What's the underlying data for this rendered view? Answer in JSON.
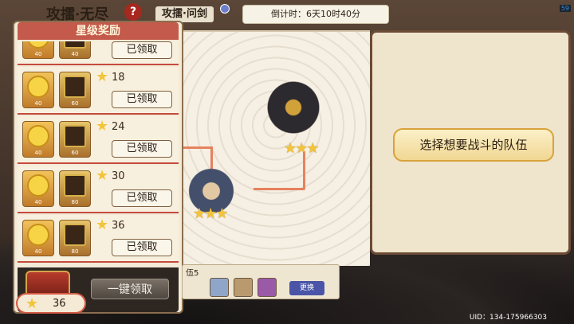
{
  "header": {
    "title": "攻擂·无尽",
    "help_glyph": "?",
    "subtitle": "攻擂·问剑",
    "countdown": "倒计时：6天10时40分",
    "corner_number": "59"
  },
  "rewards_panel": {
    "title": "星级奖励",
    "rows": [
      {
        "coin_count": "40",
        "book_count": "40",
        "stars": "",
        "button": "已领取"
      },
      {
        "coin_count": "40",
        "book_count": "60",
        "stars": "18",
        "button": "已领取"
      },
      {
        "coin_count": "40",
        "book_count": "60",
        "stars": "24",
        "button": "已领取"
      },
      {
        "coin_count": "40",
        "book_count": "80",
        "stars": "30",
        "button": "已领取"
      },
      {
        "coin_count": "40",
        "book_count": "80",
        "stars": "36",
        "button": "已领取"
      }
    ],
    "claim_all": "一键领取",
    "total_stars": "36"
  },
  "right_panel": {
    "choose_team": "选择想要战斗的队伍"
  },
  "team_bar": {
    "label": "伍5",
    "change": "更换"
  },
  "uid": "UID：134-175966303",
  "stars_glyph": "★★★",
  "star_glyph": "★",
  "colors": {
    "accent_red": "#c35a4b",
    "gold": "#f2c43a",
    "change_blue": "#4a55a8"
  }
}
